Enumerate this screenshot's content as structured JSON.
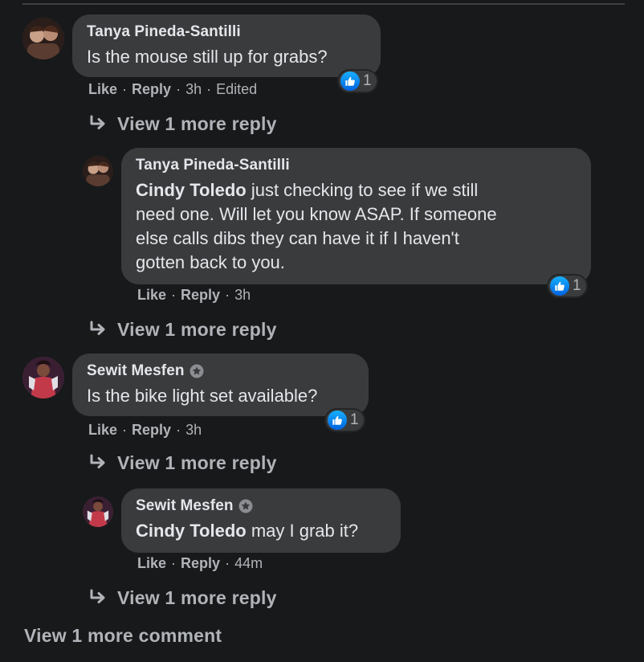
{
  "comments": [
    {
      "author": "Tanya Pineda-Santilli",
      "text": "Is the mouse still up for grabs?",
      "reaction_count": "1",
      "actions": {
        "like": "Like",
        "reply": "Reply",
        "time": "3h",
        "edited": "Edited"
      },
      "more_reply": "View 1 more reply",
      "reply": {
        "author": "Tanya Pineda-Santilli",
        "mention": "Cindy Toledo",
        "text_lines": [
          " just checking to see if we still",
          "need one. Will let you know ASAP. If someone",
          "else calls dibs they can have it if I haven't",
          "gotten back to you."
        ],
        "reaction_count": "1",
        "actions": {
          "like": "Like",
          "reply": "Reply",
          "time": "3h"
        }
      },
      "more_reply_2": "View 1 more reply"
    },
    {
      "author": "Sewit Mesfen",
      "text": "Is the bike light set available?",
      "reaction_count": "1",
      "actions": {
        "like": "Like",
        "reply": "Reply",
        "time": "3h"
      },
      "more_reply": "View 1 more reply",
      "reply": {
        "author": "Sewit Mesfen",
        "mention": "Cindy Toledo",
        "text": " may I grab it?",
        "actions": {
          "like": "Like",
          "reply": "Reply",
          "time": "44m"
        }
      },
      "more_reply_2": "View 1 more reply"
    }
  ],
  "view_more_comment": "View 1 more comment",
  "icons": {
    "like": "thumbs-up-icon",
    "reply_arrow": "reply-arrow-icon",
    "badge": "star-badge-icon"
  },
  "colors": {
    "background": "#18191a",
    "bubble": "#3a3b3c",
    "primary_text": "#e4e6eb",
    "secondary_text": "#b0b3b8",
    "like_blue": "#0a7cff"
  }
}
